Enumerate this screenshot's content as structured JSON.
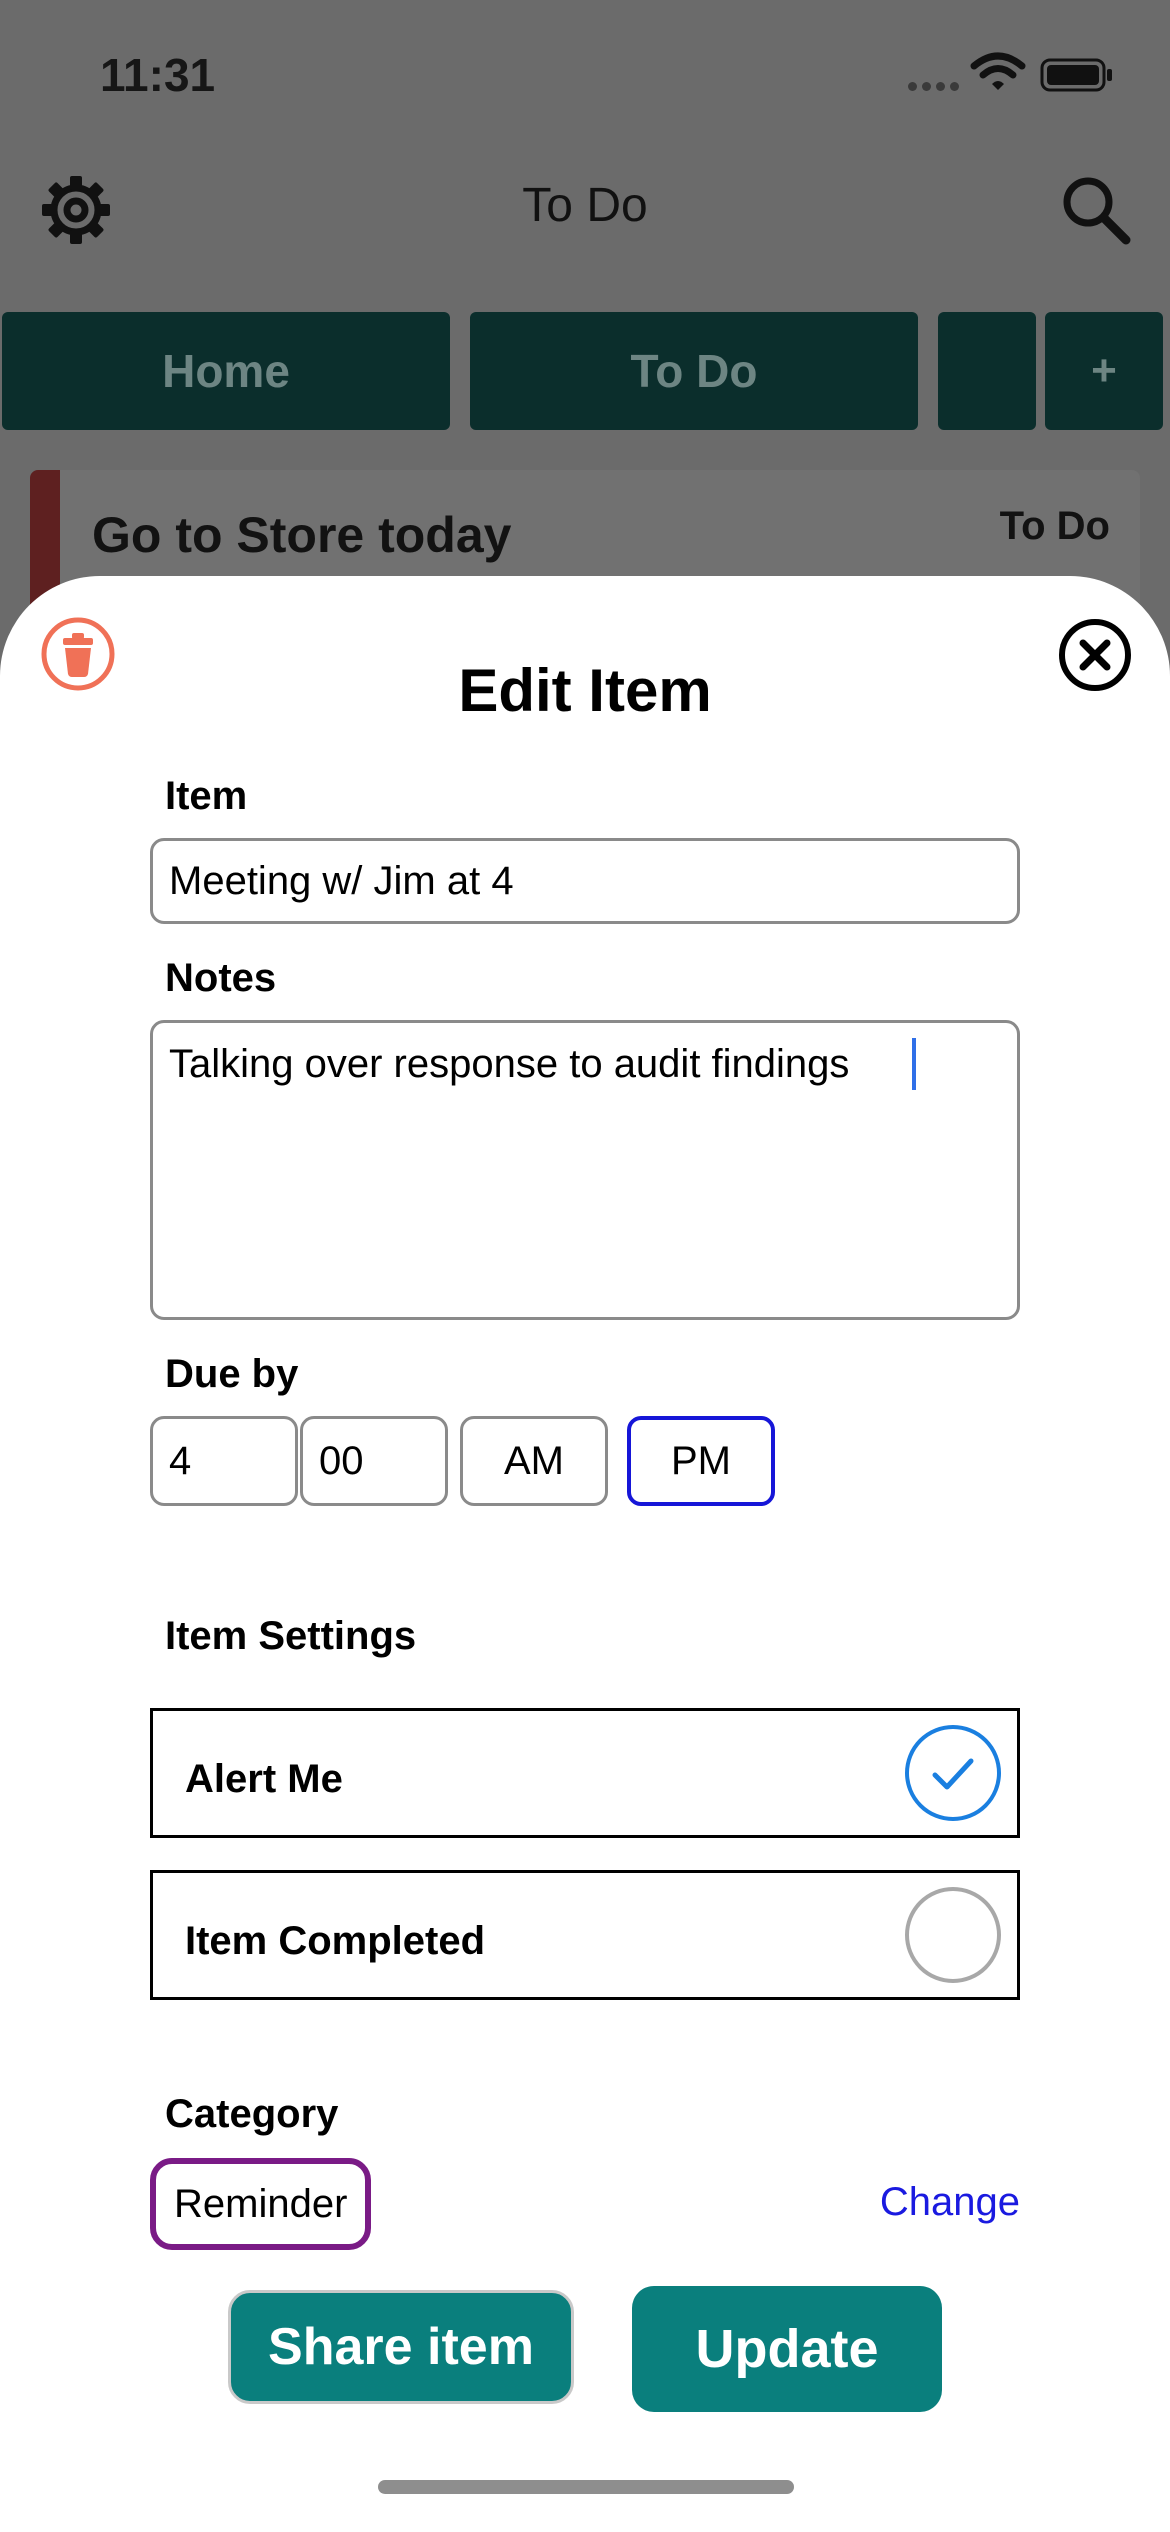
{
  "status_bar": {
    "time": "11:31",
    "icons": [
      "signal-dots-icon",
      "wifi-icon",
      "battery-icon"
    ]
  },
  "app_bar": {
    "title": "To Do",
    "left_icon": "gear-icon",
    "right_icon": "search-icon"
  },
  "tabs": [
    {
      "label": "Home"
    },
    {
      "label": "To Do"
    },
    {
      "label": ""
    },
    {
      "label": "+"
    }
  ],
  "list": {
    "items": [
      {
        "title": "Go to Store today",
        "badge": "To Do"
      }
    ]
  },
  "sheet": {
    "title": "Edit Item",
    "item_label": "Item",
    "item_value": "Meeting w/ Jim at 4",
    "notes_label": "Notes",
    "notes_value": "Talking over response to audit findings",
    "due_label": "Due by",
    "due_hour": "4",
    "due_minute": "00",
    "am_label": "AM",
    "pm_label": "PM",
    "selected_period": "PM",
    "settings_label": "Item Settings",
    "settings": [
      {
        "label": "Alert Me",
        "checked": true
      },
      {
        "label": "Item Completed",
        "checked": false
      }
    ],
    "category_label": "Category",
    "category_value": "Reminder",
    "change_label": "Change",
    "share_label": "Share item",
    "update_label": "Update"
  },
  "colors": {
    "accent": "#0a7f7d",
    "trash": "#f07157",
    "check": "#1a7fe0",
    "category_border": "#7a1b86",
    "selected_border": "#1616d8",
    "link": "#1a1ae0"
  }
}
